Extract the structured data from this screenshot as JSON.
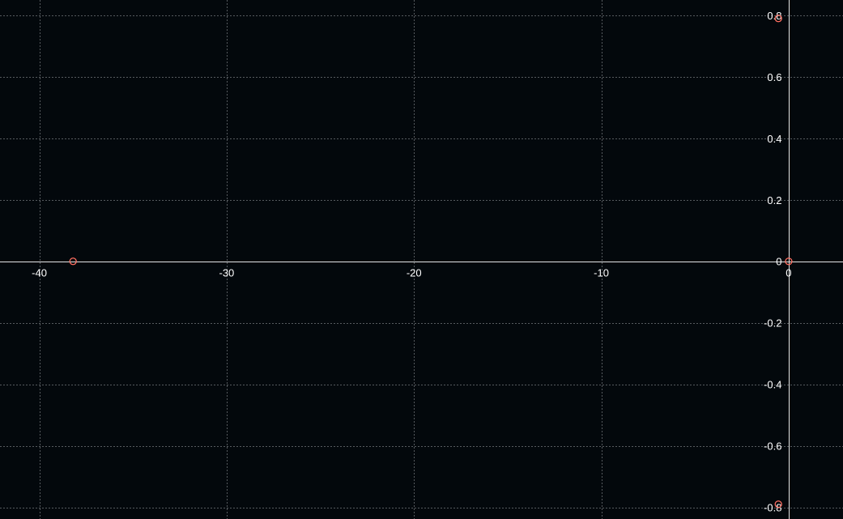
{
  "chart_data": {
    "type": "scatter",
    "title": "",
    "xlabel": "",
    "ylabel": "",
    "xlim": [
      -42.1,
      2.9
    ],
    "ylim": [
      -0.838,
      0.85
    ],
    "grid": true,
    "x_ticks": [
      -40,
      -30,
      -20,
      -10,
      0
    ],
    "x_tick_labels": [
      "-40",
      "-30",
      "-20",
      "-10",
      "0"
    ],
    "y_ticks": [
      0.8,
      0.6,
      0.4,
      0.2,
      0,
      -0.2,
      -0.4,
      -0.6,
      -0.8
    ],
    "y_tick_labels": [
      "0.8",
      "0.6",
      "0.4",
      "0.2",
      "0",
      "-0.2",
      "-0.4",
      "-0.6",
      "-0.8"
    ],
    "series": [
      {
        "marker": "hollow-circle",
        "color": "#ff6f61",
        "points": [
          {
            "x": -38.2,
            "y": 0
          },
          {
            "x": 0,
            "y": 0
          },
          {
            "x": -0.55,
            "y": 0.79
          },
          {
            "x": -0.55,
            "y": -0.79
          }
        ]
      }
    ]
  }
}
